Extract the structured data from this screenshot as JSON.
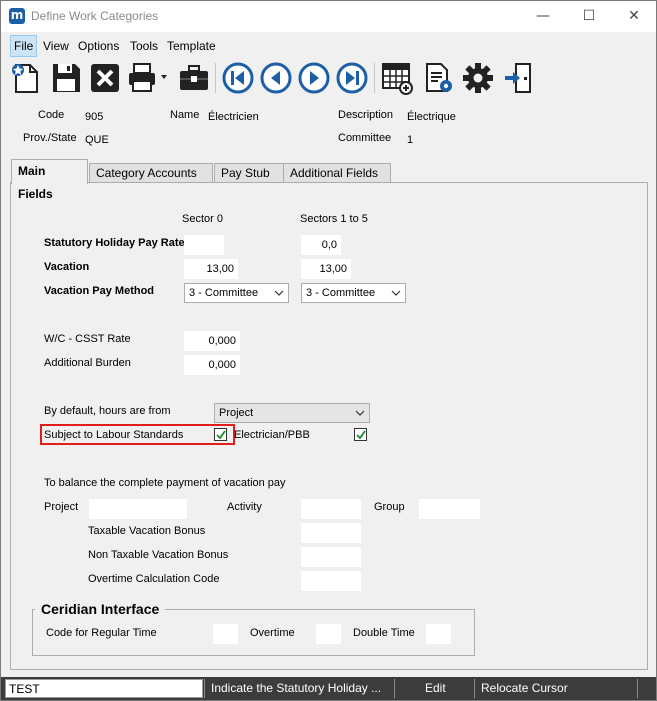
{
  "window": {
    "title": "Define Work Categories",
    "app_icon_letter": "m",
    "minimize": "—",
    "maximize": "☐",
    "close": "✕"
  },
  "menu": {
    "items": [
      "File",
      "View",
      "Options",
      "Tools",
      "Template"
    ],
    "active": "File"
  },
  "toolbar": {
    "buttons": [
      "new-icon",
      "save-icon",
      "delete-icon",
      "print-icon",
      "briefcase-icon",
      "first-record-icon",
      "previous-record-icon",
      "next-record-icon",
      "last-record-icon",
      "grid-add-icon",
      "document-settings-icon",
      "settings-gear-icon",
      "exit-icon"
    ]
  },
  "header": {
    "code_label": "Code",
    "code_value": "905",
    "name_label": "Name",
    "name_value": "Électricien",
    "description_label": "Description",
    "description_value": "Électrique",
    "prov_label": "Prov./State",
    "prov_value": "QUE",
    "committee_label": "Committee",
    "committee_value": "1"
  },
  "tabs": [
    "Main Fields",
    "Category Accounts",
    "Pay Stub",
    "Additional Fields"
  ],
  "main": {
    "sector0_header": "Sector 0",
    "sectors_header": "Sectors 1 to 5",
    "stat_holiday_label": "Statutory Holiday Pay Rate",
    "stat_holiday_sector0": "",
    "stat_holiday_sectors": "0,0",
    "vacation_label": "Vacation",
    "vacation_sector0": "13,00",
    "vacation_sectors": "13,00",
    "vacation_method_label": "Vacation Pay Method",
    "vacation_method_sector0": "3 - Committee",
    "vacation_method_sectors": "3 - Committee",
    "wc_label": "W/C - CSST Rate",
    "wc_value": "0,000",
    "burden_label": "Additional Burden",
    "burden_value": "0,000",
    "hours_from_label": "By default, hours are from",
    "hours_from_value": "Project",
    "labour_standards_label": "Subject to Labour Standards",
    "labour_standards_checked": true,
    "electrician_label": "Electrician/PBB",
    "electrician_checked": true,
    "balance_label": "To balance the complete payment of vacation pay",
    "project_label": "Project",
    "activity_label": "Activity",
    "group_label": "Group",
    "taxable_bonus_label": "Taxable Vacation Bonus",
    "nontaxable_bonus_label": "Non Taxable Vacation Bonus",
    "overtime_code_label": "Overtime Calculation Code",
    "ceridian": {
      "title": "Ceridian Interface",
      "regular_label": "Code for Regular Time",
      "overtime_label": "Overtime",
      "double_label": "Double Time"
    }
  },
  "status": {
    "input_value": "TEST",
    "message": "Indicate the Statutory Holiday ...",
    "mode": "Edit",
    "action": "Relocate Cursor"
  },
  "colors": {
    "highlight": "#e21d1d",
    "menu_active": "#cce4f7",
    "status_bg": "#3c3c3c",
    "icon_blue": "#1d5fa6",
    "check_green": "#1a8a2a"
  }
}
